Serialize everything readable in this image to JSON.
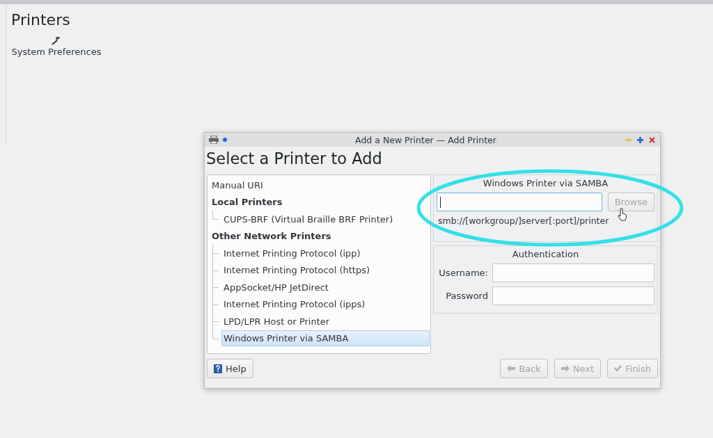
{
  "page": {
    "title": "Printers",
    "shortcut": {
      "label": "System Preferences"
    }
  },
  "dialog": {
    "title": "Add a New Printer — Add Printer",
    "heading": "Select a Printer to Add",
    "tree": [
      {
        "kind": "entry",
        "label": "Manual URI",
        "selected": false
      },
      {
        "kind": "group",
        "label": "Local Printers",
        "children": [
          {
            "kind": "entry",
            "label": "CUPS-BRF (Virtual Braille BRF Printer)",
            "selected": false
          }
        ]
      },
      {
        "kind": "group",
        "label": "Other Network Printers",
        "children": [
          {
            "kind": "entry",
            "label": "Internet Printing Protocol (ipp)",
            "selected": false
          },
          {
            "kind": "entry",
            "label": "Internet Printing Protocol (https)",
            "selected": false
          },
          {
            "kind": "entry",
            "label": "AppSocket/HP JetDirect",
            "selected": false
          },
          {
            "kind": "entry",
            "label": "Internet Printing Protocol (ipps)",
            "selected": false
          },
          {
            "kind": "entry",
            "label": "LPD/LPR Host or Printer",
            "selected": false
          },
          {
            "kind": "entry",
            "label": "Windows Printer via SAMBA",
            "selected": true
          }
        ]
      }
    ],
    "samba": {
      "title": "Windows Printer via SAMBA",
      "uri_field": {
        "focused": true
      },
      "browse": {
        "label": "Browse",
        "disabled": true
      },
      "hint": "smb://[workgroup/]server[:port]/printer"
    },
    "auth": {
      "title": "Authentication",
      "fields": [
        {
          "label": "Username:"
        },
        {
          "label": "Password"
        }
      ]
    },
    "help": {
      "label": "Help",
      "disabled": false
    },
    "nav_buttons": [
      {
        "kind": "back",
        "label": "Back",
        "disabled": true
      },
      {
        "kind": "next",
        "label": "Next",
        "disabled": true
      },
      {
        "kind": "finish",
        "label": "Finish",
        "disabled": true
      }
    ]
  }
}
